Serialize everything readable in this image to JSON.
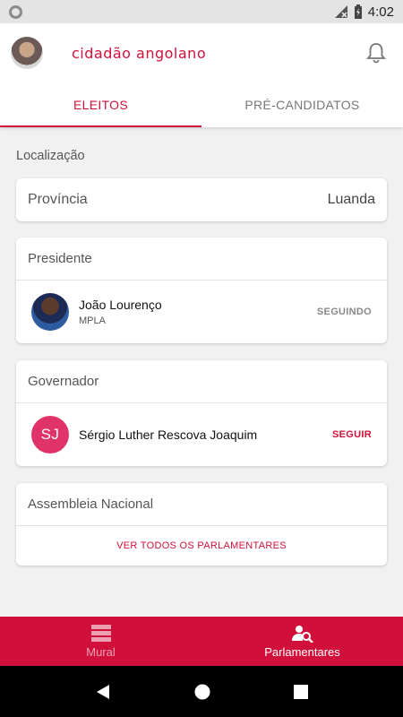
{
  "status_bar": {
    "time": "4:02"
  },
  "app_bar": {
    "brand": "cidadão angolano"
  },
  "tabs": [
    {
      "label": "ELEITOS"
    },
    {
      "label": "PRÉ-CANDIDATOS"
    }
  ],
  "location": {
    "section_label": "Localização",
    "province_label": "Província",
    "province_value": "Luanda"
  },
  "president": {
    "header": "Presidente",
    "name": "João Lourenço",
    "party": "MPLA",
    "action": "SEGUINDO"
  },
  "governor": {
    "header": "Governador",
    "initials": "SJ",
    "name": "Sérgio Luther Rescova Joaquim",
    "action": "SEGUIR"
  },
  "assembly": {
    "header": "Assembleia Nacional",
    "link": "VER TODOS OS PARLAMENTARES"
  },
  "bottom_nav": [
    {
      "label": "Mural",
      "icon": "mural-icon"
    },
    {
      "label": "Parlamentares",
      "icon": "parliamentarians-icon"
    }
  ],
  "colors": {
    "accent": "#d0103a",
    "avatar_initials_bg": "#e0336a"
  }
}
